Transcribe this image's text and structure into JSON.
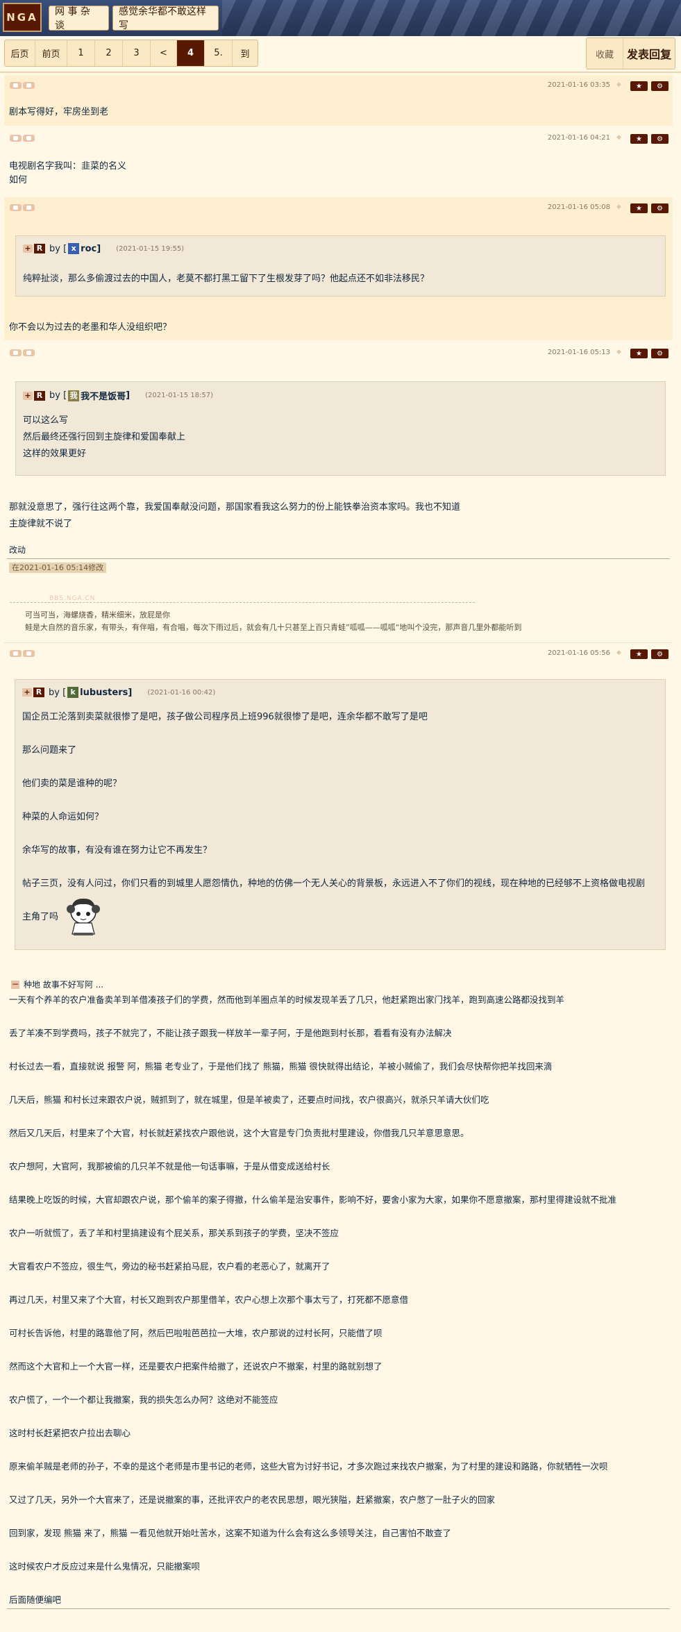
{
  "header": {
    "logo": "NGA",
    "forum": "网 事 杂 谈",
    "thread": "感觉余华都不敢这样写"
  },
  "pager": {
    "items": [
      "后页",
      "前页",
      "1",
      "2",
      "3",
      "<",
      "4",
      "5.",
      "到"
    ],
    "current": "4"
  },
  "actions": {
    "favorite": "收藏",
    "reply": "发表回复"
  },
  "icons": {
    "settings_glyph": "⚙",
    "star_glyph": "★",
    "diamond_glyph": "◆"
  },
  "posts": [
    {
      "time": "2021-01-16 03:35",
      "lines": [
        "剧本写得好，牢房坐到老"
      ]
    },
    {
      "time": "2021-01-16 04:21",
      "lines": [
        "电视剧名字我叫：韭菜的名义",
        "如何"
      ]
    },
    {
      "time": "2021-01-16 05:08",
      "quote": {
        "user": "roc",
        "avatar_letter": "x",
        "date": "(2021-01-15 19:55)",
        "lines": [
          "纯粹扯淡，那么多偷渡过去的中国人，老莫不都打黑工留下了生根发芽了吗？他起点还不如非法移民？"
        ]
      },
      "lines": [
        "你不会以为过去的老墨和华人没组织吧？"
      ]
    },
    {
      "time": "2021-01-16 05:13",
      "quote": {
        "user": "我不是饭哥",
        "avatar_letter": "我",
        "date": "(2021-01-15 18:57)",
        "lines": [
          "可以这么写",
          "然后最终还强行回到主旋律和爱国奉献上",
          "这样的效果更好"
        ]
      },
      "lines": [
        "那就没意思了，强行往这两个靠，我爱国奉献没问题，那国家看我这么努力的份上能铁拳治资本家吗。我也不知道",
        "主旋律就不说了"
      ],
      "edit_label": "改动",
      "edit_note": "在2021-01-16 05:14修改",
      "sig_watermark": "BBS.NGA.CN",
      "sig_lines": [
        "可当可当，海螺烧香，精米细米，放屁是你",
        "鲑是大自然的音乐家，有带头，有伴唱，有合唱，每次下雨过后，就会有几十只甚至上百只青蛙”呱呱——呱呱“地叫个没完，那声音几里外都能听到"
      ]
    },
    {
      "time": "2021-01-16 05:56",
      "quote": {
        "user": "lubusters",
        "avatar_letter": "k",
        "date": "(2021-01-16 00:42)",
        "lines": [
          "国企员工沦落到卖菜就很惨了是吧，孩子做公司程序员上班996就很惨了是吧，连余华都不敢写了是吧",
          "那么问题来了",
          "他们卖的菜是谁种的呢？",
          "种菜的人命运如何？",
          "余华写的故事，有没有谁在努力让它不再发生？",
          "帖子三页，没有人问过，你们只看的到城里人愿怨情仇，种地的仿佛一个无人关心的背景板，永远进入不了你们的视线，现在种地的已经够不上资格做电视剧",
          "主角了吗"
        ]
      },
      "collapse_title": "种地 故事不好写阿 ...",
      "lines": [
        "一天有个养羊的农户准备卖羊到羊借凑孩子们的学费，然而他到羊圈点羊的时候发现羊丢了几只，他赶紧跑出家门找羊，跑到高速公路都没找到羊",
        "丢了羊凑不到学费吗，孩子不就完了，不能让孩子跟我一样放羊一辈子阿，于是他跑到村长那，看看有没有办法解决",
        "村长过去一看，直接就说 报警 阿，熊猫 老专业了，于是他们找了 熊猫，熊猫 很快就得出结论，羊被小贼偷了，我们会尽快帮你把羊找回来滴",
        "几天后，熊猫 和村长过来跟农户说，贼抓到了，就在城里，但是羊被卖了，还要点时间找，农户很高兴，就杀只羊请大伙们吃",
        "然后又几天后，村里来了个大官，村长就赶紧找农户跟他说，这个大官是专门负责批村里建设，你借我几只羊意思意思。",
        "农户想阿，大官阿，我那被偷的几只羊不就是他一句话事嘛，于是从借变成送给村长",
        "结果晚上吃饭的时候，大官却跟农户说，那个偷羊的案子得撤，什么偷羊是治安事件，影响不好，要舍小家为大家，如果你不愿意撤案，那村里得建设就不批准",
        "农户一听就慌了，丢了羊和村里搞建设有个屁关系，那关系到孩子的学费，坚决不签应",
        "大官看农户不签应，很生气，旁边的秘书赶紧拍马屁，农户看的老恶心了，就离开了",
        "再过几天，村里又来了个大官，村长又跑到农户那里借羊，农户心想上次那个事太亏了，打死都不愿意借",
        "可村长告诉他，村里的路靠他了阿，然后巴啦啦芭芭拉一大堆，农户那说的过村长阿，只能借了呗",
        "然而这个大官和上一个大官一样，还是要农户把案件给撤了，还说农户不撤案，村里的路就别想了",
        "农户慌了，一个一个都让我撤案，我的损失怎么办阿？这绝对不能签应",
        "这时村长赶紧把农户拉出去聊心",
        "原来偷羊贼是老师的孙子，不幸的是这个老师是市里书记的老师，这些大官为讨好书记，才多次跑过来找农户撤案，为了村里的建设和路路，你就牺牲一次呗",
        "又过了几天，另外一个大官来了，还是说撤案的事，还批评农户的老农民思想，眼光狭隘，赶紧撤案，农户憋了一肚子火的回家",
        "回到家，发现 熊猫 来了，熊猫 一看见他就开始吐苦水，这案不知道为什么会有这么多领导关注，自己害怕不敢查了",
        "这时候农户才反应过来是什么鬼情况，只能撤案呗",
        "后面随便编吧"
      ]
    }
  ]
}
